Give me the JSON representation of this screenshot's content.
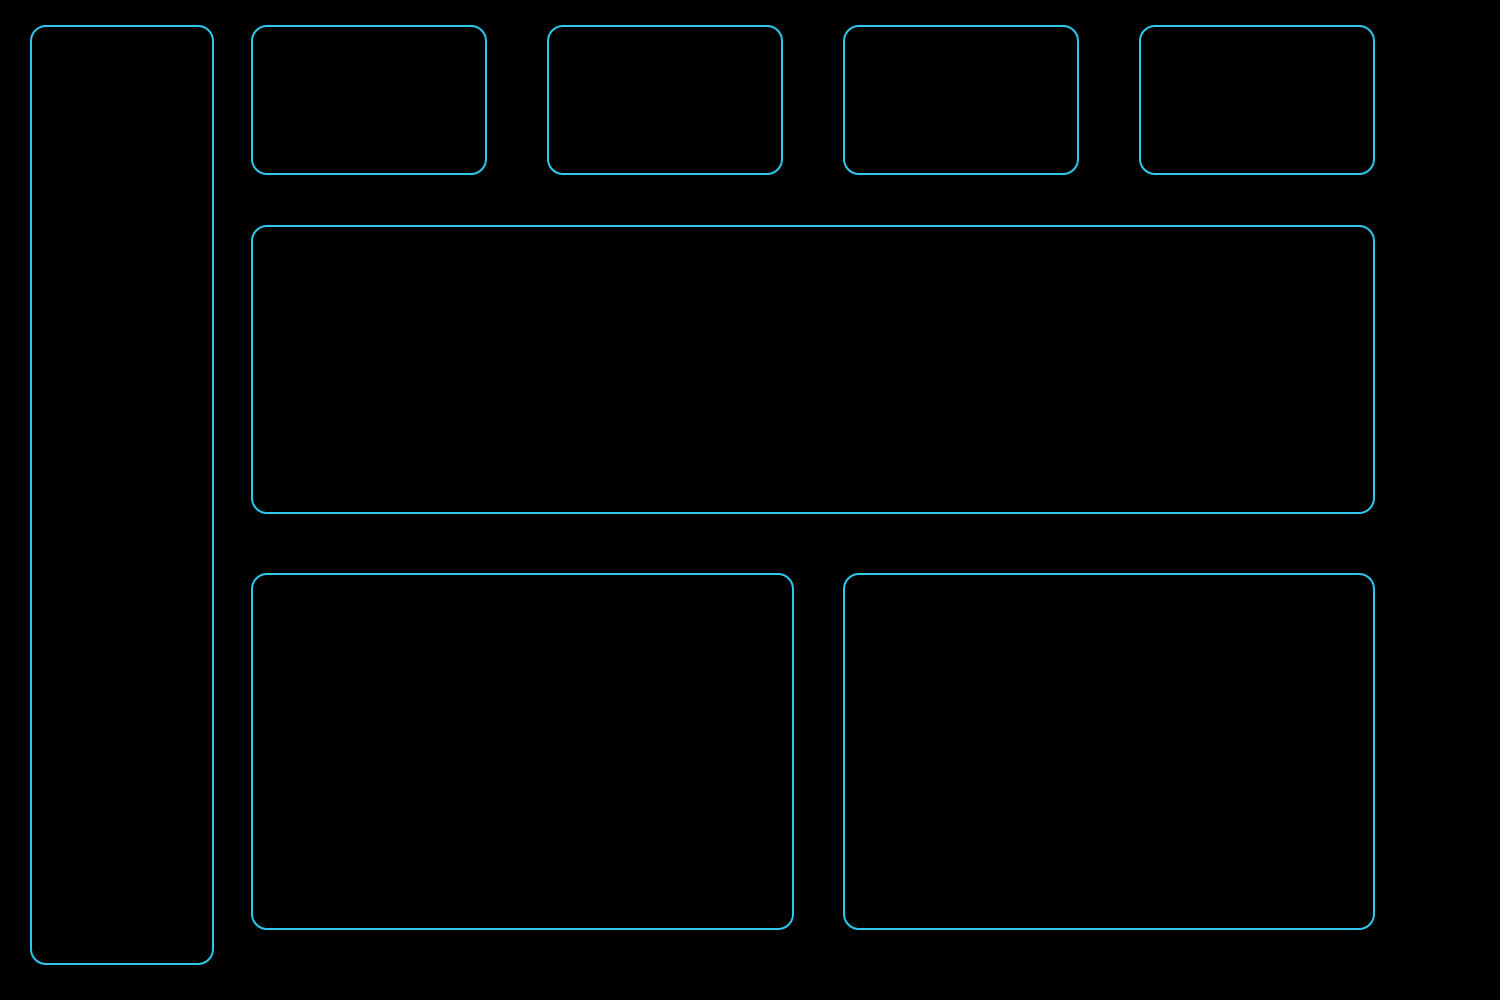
{
  "theme": {
    "background": "#000000",
    "outline": "#2ec8ee"
  },
  "layout": {
    "sidebar": {
      "content": ""
    },
    "stat_cards": [
      {
        "content": ""
      },
      {
        "content": ""
      },
      {
        "content": ""
      },
      {
        "content": ""
      }
    ],
    "main_panel": {
      "content": ""
    },
    "bottom_panels": [
      {
        "content": ""
      },
      {
        "content": ""
      }
    ]
  }
}
